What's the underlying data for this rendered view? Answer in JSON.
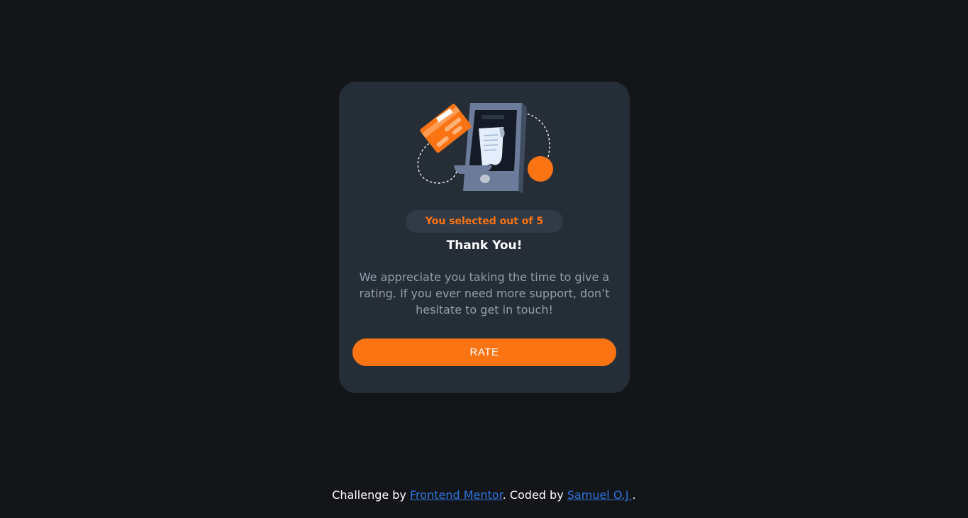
{
  "card": {
    "illustration_icon": "phone-receipt-card-illustration",
    "badge_text": "You selected out of 5",
    "title": "Thank You!",
    "description": "We appreciate you taking the time to give a rating. If you ever need more support, don’t hesitate to get in touch!",
    "button_label": "RATE"
  },
  "footer": {
    "prefix": "Challenge by ",
    "link1": "Frontend Mentor",
    "middle": ". Coded by ",
    "link2": "Samuel O.J ",
    "suffix": "."
  },
  "colors": {
    "background": "#131518",
    "card": "#252d37",
    "accent": "#fb7413",
    "muted_text": "#959eac",
    "link": "#2f74e0"
  }
}
